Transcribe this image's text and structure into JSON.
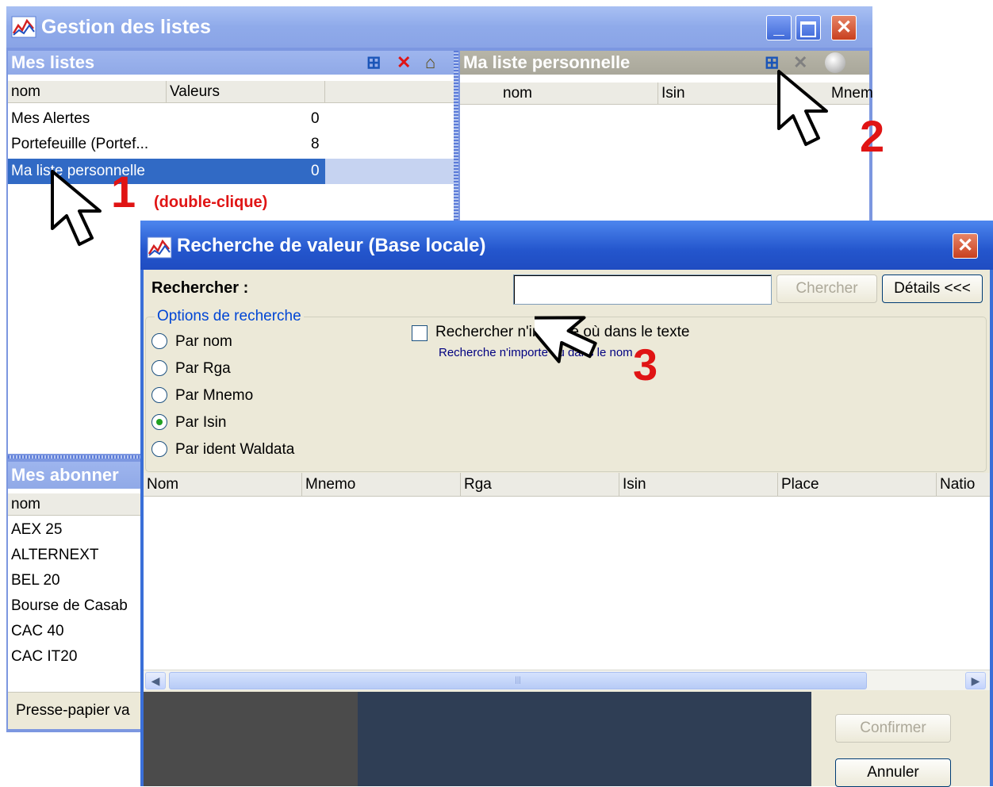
{
  "main_window": {
    "title": "Gestion des listes",
    "title_icon": "chart-app-icon",
    "controls": [
      "minimize",
      "maximize",
      "close"
    ]
  },
  "lists_panel": {
    "header": "Mes listes",
    "toolbar_icons": [
      "new-list-icon",
      "delete-icon",
      "properties-icon"
    ],
    "columns": [
      "nom",
      "Valeurs"
    ],
    "rows": [
      {
        "nom": "Mes Alertes",
        "valeurs": "0"
      },
      {
        "nom": "Portefeuille (Portef...",
        "valeurs": "8"
      },
      {
        "nom": "Ma liste personnelle",
        "valeurs": "0",
        "selected": true
      }
    ]
  },
  "personal_panel": {
    "header": "Ma liste personnelle",
    "toolbar_icons": [
      "add-value-icon",
      "delete-icon",
      "globe-icon"
    ],
    "columns": [
      "nom",
      "Isin",
      "Mnem"
    ]
  },
  "subscriptions_panel": {
    "header": "Mes abonner",
    "columns": [
      "nom"
    ],
    "rows": [
      "AEX 25",
      "ALTERNEXT",
      "BEL 20",
      "Bourse de Casab",
      "CAC 40",
      "CAC IT20"
    ],
    "footer": "Presse-papier va"
  },
  "search_dialog": {
    "title": "Recherche de valeur (Base locale)",
    "search_label": "Rechercher :",
    "search_value": "",
    "search_button": "Chercher",
    "details_button": "Détails <<<",
    "options_group": "Options de recherche",
    "radio_options": [
      {
        "label": "Par nom",
        "checked": false
      },
      {
        "label": "Par Rga",
        "checked": false
      },
      {
        "label": "Par Mnemo",
        "checked": false
      },
      {
        "label": "Par Isin",
        "checked": true
      },
      {
        "label": "Par ident Waldata",
        "checked": false
      }
    ],
    "anywhere_checkbox_label": "Rechercher n'importe où dans le texte",
    "anywhere_checkbox_checked": false,
    "anywhere_hint": "Recherche n'importe où dans le nom",
    "result_columns": [
      "Nom",
      "Mnemo",
      "Rga",
      "Isin",
      "Place",
      "Natio"
    ],
    "confirm_button": "Confirmer",
    "cancel_button": "Annuler"
  },
  "annotations": {
    "step1_number": "1",
    "step1_note": "(double-clique)",
    "step2_number": "2",
    "step3_number": "3",
    "color": "#e01414"
  },
  "colors": {
    "xp_blue_title": "#2456cd",
    "panel_header_blue": "#90a9e7",
    "selection_blue": "#316ac5",
    "annotation_red": "#e01414"
  }
}
